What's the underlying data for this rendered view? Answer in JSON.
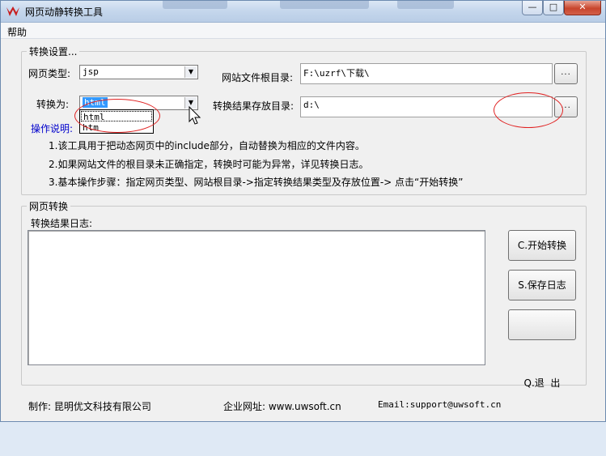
{
  "window": {
    "title": "网页动静转换工具",
    "controls": [
      "—",
      "□",
      "✕"
    ]
  },
  "menu": {
    "help": "帮助"
  },
  "settings": {
    "group_title": "转换设置...",
    "page_type_label": "网页类型:",
    "page_type_value": "jsp",
    "convert_to_label": "转换为:",
    "convert_to_value": "html",
    "convert_options": [
      "html",
      "htm"
    ],
    "root_dir_label": "网站文件根目录:",
    "root_dir_value": "F:\\uzrf\\下载\\",
    "result_dir_label": "转换结果存放目录:",
    "result_dir_value": "d:\\",
    "browse_label": "...",
    "instructions_title": "操作说明:",
    "instructions": [
      "1.该工具用于把动态网页中的include部分，自动替换为相应的文件内容。",
      "2.如果网站文件的根目录未正确指定，转换时可能为异常，详见转换日志。",
      "3.基本操作步骤：指定网页类型、网站根目录->指定转换结果类型及存放位置-> 点击“开始转换”"
    ]
  },
  "convert": {
    "group_title": "网页转换",
    "log_label": "转换结果日志:",
    "start_button": "C.开始转换",
    "save_button": "S.保存日志",
    "exit_button": "Q.退  出"
  },
  "footer": {
    "maker": "制作: 昆明优文科技有限公司",
    "website": "企业网址: www.uwsoft.cn",
    "email": "Email:support@uwsoft.cn"
  },
  "colors": {
    "accent_blue": "#0000cc",
    "annotation_red": "#e02020",
    "selection": "#3399ff"
  }
}
